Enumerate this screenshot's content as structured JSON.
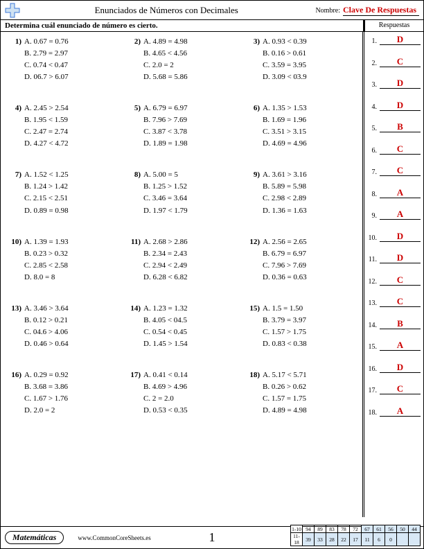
{
  "header": {
    "title": "Enunciados de Números con Decimales",
    "name_label": "Nombre:",
    "key_label": "Clave De Respuestas"
  },
  "instruction": "Determina cuál enunciado de número es cierto.",
  "answers_header": "Respuestas",
  "questions": [
    {
      "n": "1)",
      "a": "A. 0.67 = 0.76",
      "b": "B. 2.79 = 2.97",
      "c": "C. 0.74 < 0.47",
      "d": "D. 06.7 > 6.07"
    },
    {
      "n": "2)",
      "a": "A. 4.89 = 4.98",
      "b": "B. 4.65 < 4.56",
      "c": "C. 2.0 = 2",
      "d": "D. 5.68 = 5.86"
    },
    {
      "n": "3)",
      "a": "A. 0.93 < 0.39",
      "b": "B. 0.16 > 0.61",
      "c": "C. 3.59 = 3.95",
      "d": "D. 3.09 < 03.9"
    },
    {
      "n": "4)",
      "a": "A. 2.45 > 2.54",
      "b": "B. 1.95 < 1.59",
      "c": "C. 2.47 = 2.74",
      "d": "D. 4.27 < 4.72"
    },
    {
      "n": "5)",
      "a": "A. 6.79 = 6.97",
      "b": "B. 7.96 > 7.69",
      "c": "C. 3.87 < 3.78",
      "d": "D. 1.89 = 1.98"
    },
    {
      "n": "6)",
      "a": "A. 1.35 > 1.53",
      "b": "B. 1.69 = 1.96",
      "c": "C. 3.51 > 3.15",
      "d": "D. 4.69 = 4.96"
    },
    {
      "n": "7)",
      "a": "A. 1.52 < 1.25",
      "b": "B. 1.24 > 1.42",
      "c": "C. 2.15 < 2.51",
      "d": "D. 0.89 = 0.98"
    },
    {
      "n": "8)",
      "a": "A. 5.00 = 5",
      "b": "B. 1.25 > 1.52",
      "c": "C. 3.46 = 3.64",
      "d": "D. 1.97 < 1.79"
    },
    {
      "n": "9)",
      "a": "A. 3.61 > 3.16",
      "b": "B. 5.89 = 5.98",
      "c": "C. 2.98 < 2.89",
      "d": "D. 1.36 = 1.63"
    },
    {
      "n": "10)",
      "a": "A. 1.39 = 1.93",
      "b": "B. 0.23 > 0.32",
      "c": "C. 2.85 < 2.58",
      "d": "D. 8.0 = 8"
    },
    {
      "n": "11)",
      "a": "A. 2.68 > 2.86",
      "b": "B. 2.34 = 2.43",
      "c": "C. 2.94 < 2.49",
      "d": "D. 6.28 < 6.82"
    },
    {
      "n": "12)",
      "a": "A. 2.56 = 2.65",
      "b": "B. 6.79 = 6.97",
      "c": "C. 7.96 > 7.69",
      "d": "D. 0.36 = 0.63"
    },
    {
      "n": "13)",
      "a": "A. 3.46 > 3.64",
      "b": "B. 0.12 > 0.21",
      "c": "C. 04.6 > 4.06",
      "d": "D. 0.46 > 0.64"
    },
    {
      "n": "14)",
      "a": "A. 1.23 = 1.32",
      "b": "B. 4.05 < 04.5",
      "c": "C. 0.54 < 0.45",
      "d": "D. 1.45 > 1.54"
    },
    {
      "n": "15)",
      "a": "A. 1.5 = 1.50",
      "b": "B. 3.79 = 3.97",
      "c": "C. 1.57 > 1.75",
      "d": "D. 0.83 < 0.38"
    },
    {
      "n": "16)",
      "a": "A. 0.29 = 0.92",
      "b": "B. 3.68 = 3.86",
      "c": "C. 1.67 > 1.76",
      "d": "D. 2.0 = 2"
    },
    {
      "n": "17)",
      "a": "A. 0.41 < 0.14",
      "b": "B. 4.69 > 4.96",
      "c": "C. 2 = 2.0",
      "d": "D. 0.53 < 0.35"
    },
    {
      "n": "18)",
      "a": "A. 5.17 < 5.71",
      "b": "B. 0.26 > 0.62",
      "c": "C. 1.57 = 1.75",
      "d": "D. 4.89 = 4.98"
    }
  ],
  "answers": [
    {
      "n": "1.",
      "v": "D"
    },
    {
      "n": "2.",
      "v": "C"
    },
    {
      "n": "3.",
      "v": "D"
    },
    {
      "n": "4.",
      "v": "D"
    },
    {
      "n": "5.",
      "v": "B"
    },
    {
      "n": "6.",
      "v": "C"
    },
    {
      "n": "7.",
      "v": "C"
    },
    {
      "n": "8.",
      "v": "A"
    },
    {
      "n": "9.",
      "v": "A"
    },
    {
      "n": "10.",
      "v": "D"
    },
    {
      "n": "11.",
      "v": "D"
    },
    {
      "n": "12.",
      "v": "C"
    },
    {
      "n": "13.",
      "v": "C"
    },
    {
      "n": "14.",
      "v": "B"
    },
    {
      "n": "15.",
      "v": "A"
    },
    {
      "n": "16.",
      "v": "D"
    },
    {
      "n": "17.",
      "v": "C"
    },
    {
      "n": "18.",
      "v": "A"
    }
  ],
  "footer": {
    "subject": "Matemáticas",
    "site": "www.CommonCoreSheets.es",
    "page": "1",
    "score": {
      "row1_label": "1-10",
      "row2_label": "11-18",
      "row1": [
        "94",
        "89",
        "83",
        "78",
        "72",
        "67",
        "61",
        "56",
        "50",
        "44"
      ],
      "row2": [
        "39",
        "33",
        "28",
        "22",
        "17",
        "11",
        "6",
        "0",
        "",
        ""
      ]
    }
  }
}
